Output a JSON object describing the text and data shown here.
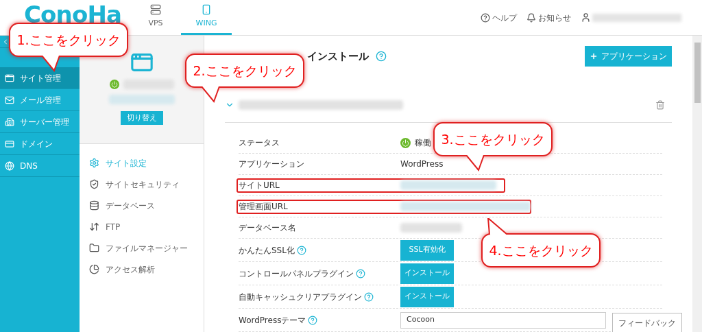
{
  "logo": "ConoHa",
  "top_tabs": [
    {
      "label": "VPS",
      "selected": false
    },
    {
      "label": "WING",
      "selected": true
    }
  ],
  "header_links": [
    {
      "label": "ヘルプ"
    },
    {
      "label": "お知らせ"
    }
  ],
  "sidebar": {
    "items": [
      {
        "label": "サイト管理",
        "selected": true
      },
      {
        "label": "メール管理",
        "selected": false
      },
      {
        "label": "サーバー管理",
        "selected": false
      },
      {
        "label": "ドメイン",
        "selected": false
      },
      {
        "label": "DNS",
        "selected": false
      }
    ]
  },
  "site_panel": {
    "switch_button": "切り替え",
    "menu": [
      {
        "label": "サイト設定",
        "selected": true
      },
      {
        "label": "サイトセキュリティ",
        "selected": false
      },
      {
        "label": "データベース",
        "selected": false
      },
      {
        "label": "FTP",
        "selected": false
      },
      {
        "label": "ファイルマネージャー",
        "selected": false
      },
      {
        "label": "アクセス解析",
        "selected": false
      }
    ]
  },
  "main": {
    "title": "インストール",
    "add_button": "アプリケーション",
    "rows": [
      {
        "label": "ステータス",
        "kind": "status",
        "value": "稼働"
      },
      {
        "label": "アプリケーション",
        "kind": "text",
        "value": "WordPress"
      },
      {
        "label": "サイトURL",
        "kind": "blurred",
        "highlighted": true
      },
      {
        "label": "管理画面URL",
        "kind": "blurred",
        "highlighted": true
      },
      {
        "label": "データベース名",
        "kind": "blurred",
        "highlighted": false
      },
      {
        "label": "かんたんSSL化",
        "kind": "button",
        "help": true,
        "value": "SSL有効化"
      },
      {
        "label": "コントロールパネルプラグイン",
        "kind": "button",
        "help": true,
        "value": "インストール"
      },
      {
        "label": "自動キャッシュクリアプラグイン",
        "kind": "button",
        "help": true,
        "value": "インストール"
      },
      {
        "label": "WordPressテーマ",
        "kind": "select",
        "help": true,
        "value": "Cocoon"
      }
    ]
  },
  "feedback": "フィードバック",
  "callouts": [
    {
      "text": "1.ここをクリック"
    },
    {
      "text": "2.ここをクリック"
    },
    {
      "text": "3.ここをクリック"
    },
    {
      "text": "4.ここをクリック"
    }
  ]
}
